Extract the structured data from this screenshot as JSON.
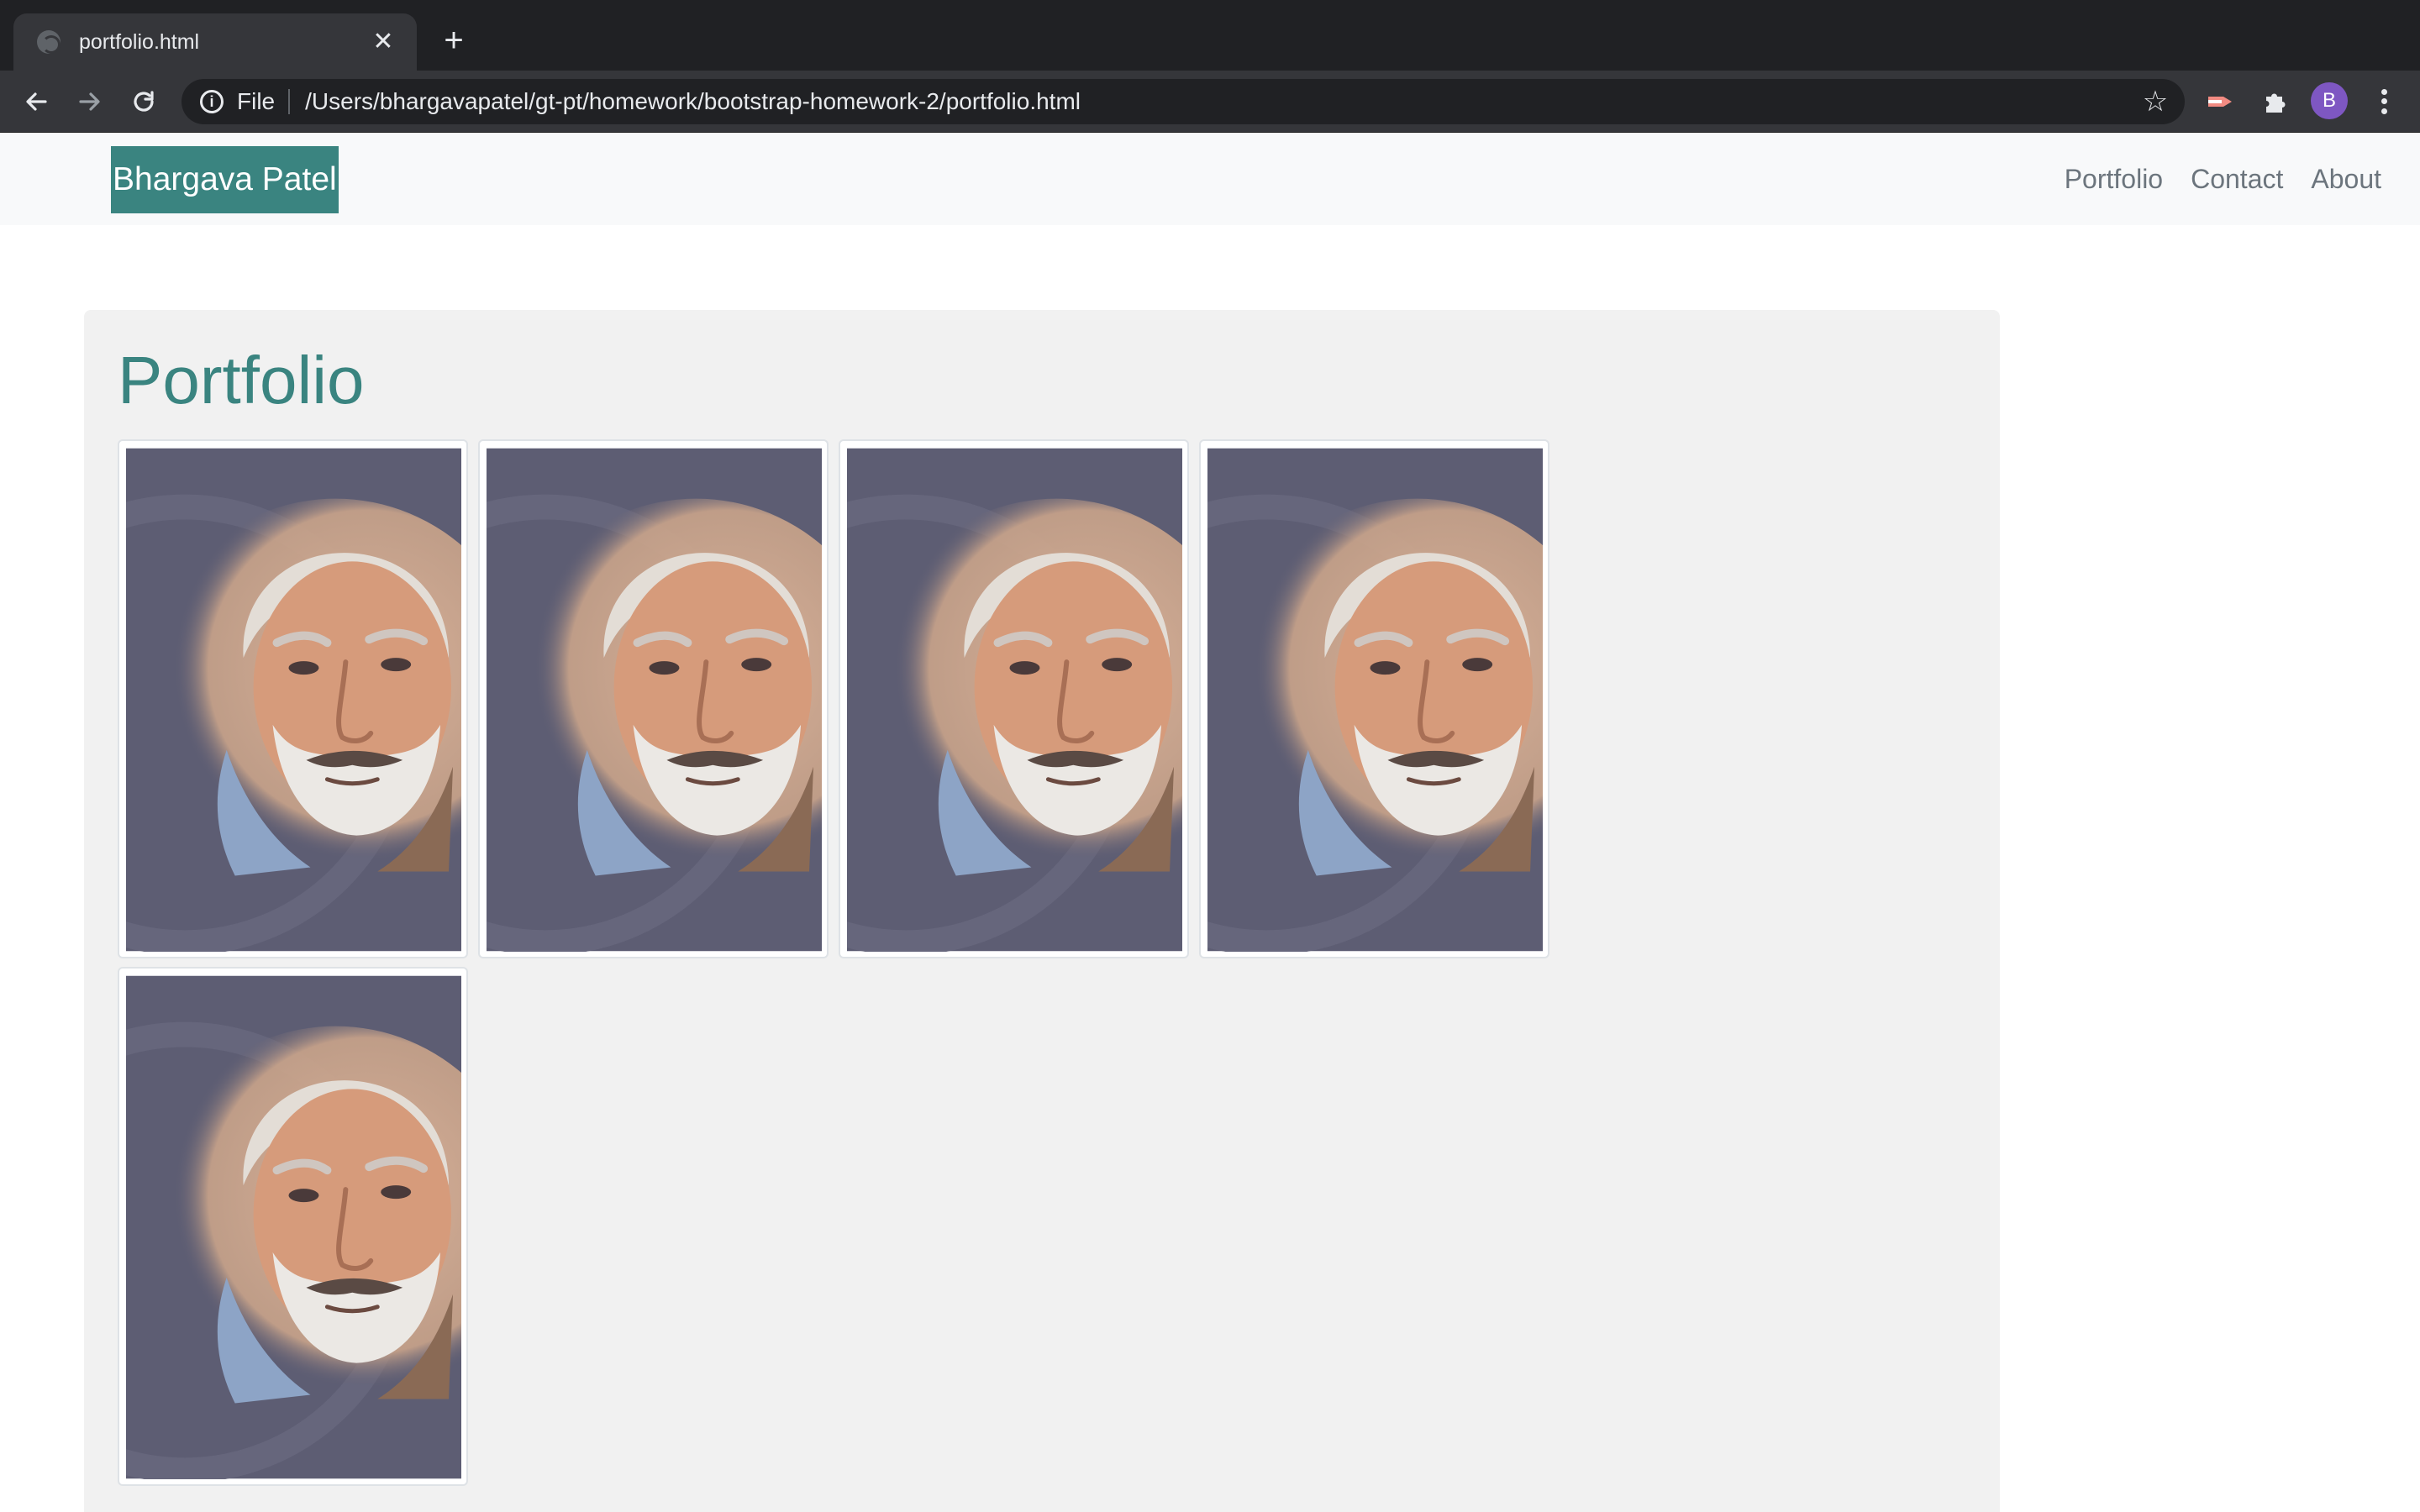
{
  "browser": {
    "tab": {
      "title": "portfolio.html",
      "favicon": "globe-icon"
    },
    "address_bar": {
      "scheme_label": "File",
      "url": "/Users/bhargavapatel/gt-pt/homework/bootstrap-homework-2/portfolio.html"
    },
    "profile_initial": "B",
    "icons": [
      "back-arrow-icon",
      "forward-arrow-icon",
      "reload-icon",
      "info-icon",
      "star-icon",
      "extension-icon",
      "puzzle-icon",
      "kebab-menu-icon"
    ]
  },
  "site": {
    "brand": "Bhargava Patel",
    "nav": [
      "Portfolio",
      "Contact",
      "About"
    ],
    "heading": "Portfolio",
    "gallery": {
      "image_count": 5,
      "image": "portrait of a grey-bearded man in a circular vignette"
    }
  },
  "colors": {
    "accent": "#3a8480",
    "navbar_bg": "#f8f9fa",
    "jumbotron_bg": "#f1f1f1",
    "browser_dark": "#202124",
    "browser_toolbar": "#35363a"
  }
}
